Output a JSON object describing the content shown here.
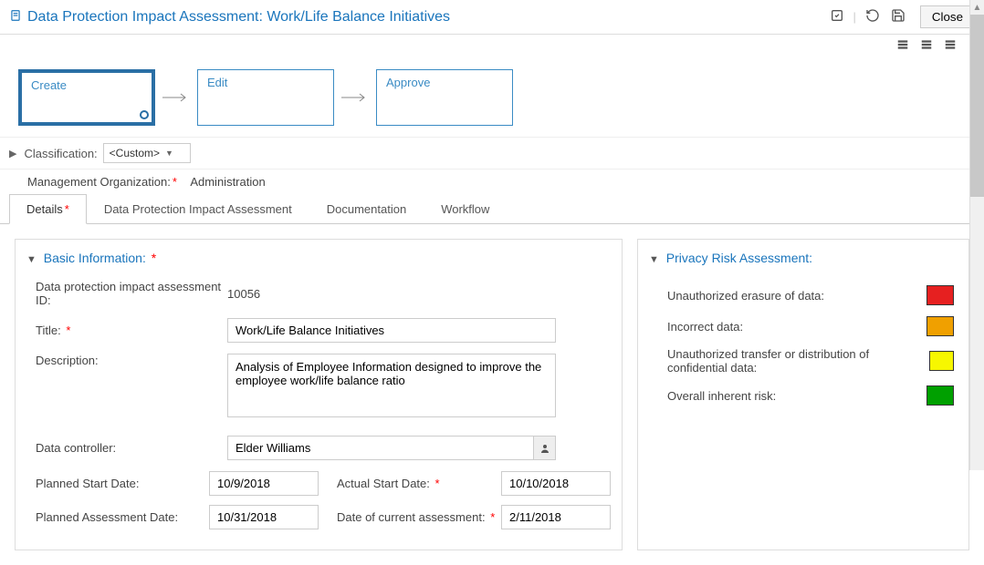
{
  "header": {
    "title": "Data Protection Impact Assessment: Work/Life Balance Initiatives",
    "close_label": "Close"
  },
  "workflow": {
    "steps": [
      "Create",
      "Edit",
      "Approve"
    ]
  },
  "classification": {
    "label": "Classification:",
    "value": "<Custom>"
  },
  "mgmt_org": {
    "label": "Management Organization:",
    "value": "Administration"
  },
  "tabs": [
    "Details",
    "Data Protection Impact Assessment",
    "Documentation",
    "Workflow"
  ],
  "basic_info": {
    "heading": "Basic Information:",
    "id_label": "Data protection impact assessment ID:",
    "id_value": "10056",
    "title_label": "Title:",
    "title_value": "Work/Life Balance Initiatives",
    "desc_label": "Description:",
    "desc_value": "Analysis of Employee Information designed to improve the employee work/life balance ratio",
    "controller_label": "Data controller:",
    "controller_value": "Elder Williams",
    "planned_start_label": "Planned Start Date:",
    "planned_start_value": "10/9/2018",
    "actual_start_label": "Actual Start Date:",
    "actual_start_value": "10/10/2018",
    "planned_assess_label": "Planned Assessment Date:",
    "planned_assess_value": "10/31/2018",
    "current_assess_label": "Date of current assessment:",
    "current_assess_value": "2/11/2018"
  },
  "risk": {
    "heading": "Privacy Risk Assessment:",
    "items": [
      {
        "label": "Unauthorized erasure of data:",
        "color": "red"
      },
      {
        "label": "Incorrect data:",
        "color": "orange"
      },
      {
        "label": "Unauthorized transfer or distribution of confidential data:",
        "color": "yellow"
      },
      {
        "label": "Overall inherent risk:",
        "color": "green"
      }
    ]
  }
}
